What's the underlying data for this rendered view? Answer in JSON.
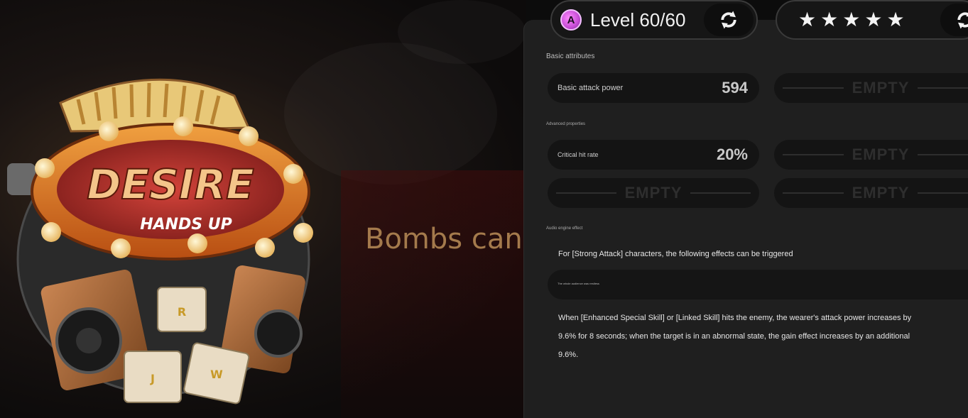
{
  "slogan": "Bombs can",
  "level": {
    "badge": "A",
    "text": "Level 60/60"
  },
  "rarity_stars": 5,
  "sections": {
    "basic": "Basic attributes",
    "advanced": "Advanced properties",
    "audio": "Audio engine effect"
  },
  "basic_stats": [
    {
      "name": "Basic attack power",
      "value": "594"
    }
  ],
  "advanced_stats": [
    {
      "name": "Critical hit rate",
      "value": "20%"
    }
  ],
  "empty_label": "EMPTY",
  "audio_effect": {
    "title": "For [Strong Attack] characters, the following effects can be triggered",
    "note": "The whole audience was restless",
    "description": "When [Enhanced Special Skill] or [Linked Skill] hits the enemy, the wearer's attack power increases by 9.6% for 8 seconds; when the target is in an abnormal state, the gain effect increases by an additional 9.6%."
  },
  "artwork": {
    "sign_main": "DESIRE",
    "sign_sub": "HANDS UP",
    "cube_letters": [
      "R",
      "J",
      "W"
    ]
  },
  "colors": {
    "accent_gold": "#a47a4c",
    "panel_bg": "#1f1f1f",
    "badge_pink": "#c64cd6"
  }
}
